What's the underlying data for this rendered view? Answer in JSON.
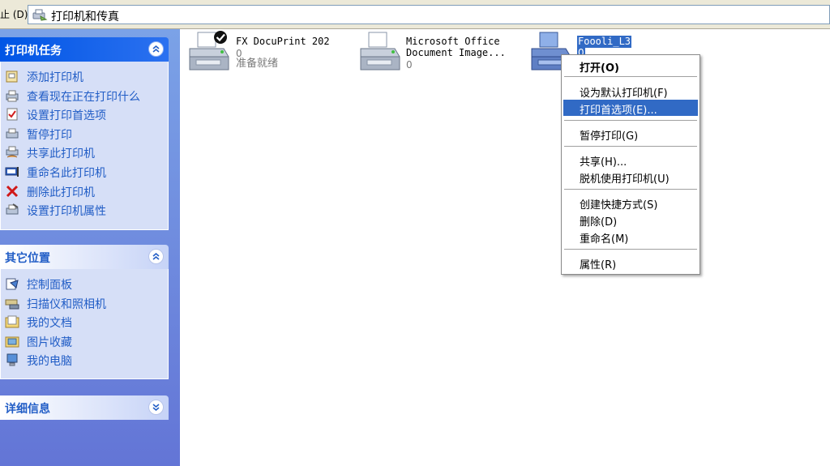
{
  "address_bar": {
    "label": "止 (D)",
    "path": "打印机和传真"
  },
  "sidebar": {
    "printer_tasks": {
      "title": "打印机任务",
      "items": [
        {
          "label": "添加打印机",
          "icon": "add-printer-icon"
        },
        {
          "label": "查看现在正在打印什么",
          "icon": "print-queue-icon"
        },
        {
          "label": "设置打印首选项",
          "icon": "print-preferences-icon"
        },
        {
          "label": "暂停打印",
          "icon": "pause-printer-icon"
        },
        {
          "label": "共享此打印机",
          "icon": "share-printer-icon"
        },
        {
          "label": "重命名此打印机",
          "icon": "rename-icon"
        },
        {
          "label": "删除此打印机",
          "icon": "delete-icon"
        },
        {
          "label": "设置打印机属性",
          "icon": "printer-properties-icon"
        }
      ]
    },
    "other_places": {
      "title": "其它位置",
      "items": [
        {
          "label": "控制面板",
          "icon": "control-panel-icon"
        },
        {
          "label": "扫描仪和照相机",
          "icon": "scanner-camera-icon"
        },
        {
          "label": "我的文档",
          "icon": "my-documents-icon"
        },
        {
          "label": "图片收藏",
          "icon": "my-pictures-icon"
        },
        {
          "label": "我的电脑",
          "icon": "my-computer-icon"
        }
      ]
    },
    "details": {
      "title": "详细信息"
    }
  },
  "printers": [
    {
      "name": "FX DocuPrint 202",
      "count": "0",
      "status": "准备就绪",
      "default": true
    },
    {
      "name": "Microsoft Office",
      "name2": "Document Image...",
      "count": "0"
    },
    {
      "name": "Foooli_L3",
      "count": "0",
      "selected": true
    }
  ],
  "context_menu": {
    "items": [
      {
        "label": "打开(O)",
        "bold": true
      },
      {
        "label": "设为默认打印机(F)"
      },
      {
        "label": "打印首选项(E)...",
        "highlighted": true
      },
      {
        "label": "暂停打印(G)"
      },
      {
        "label": "共享(H)..."
      },
      {
        "label": "脱机使用打印机(U)"
      },
      {
        "label": "创建快捷方式(S)"
      },
      {
        "label": "删除(D)"
      },
      {
        "label": "重命名(M)"
      },
      {
        "label": "属性(R)"
      }
    ]
  },
  "colors": {
    "sidebar_top": "#7ba2e7",
    "sidebar_bottom": "#6375d6",
    "link": "#215dc6",
    "selection": "#316ac5"
  }
}
